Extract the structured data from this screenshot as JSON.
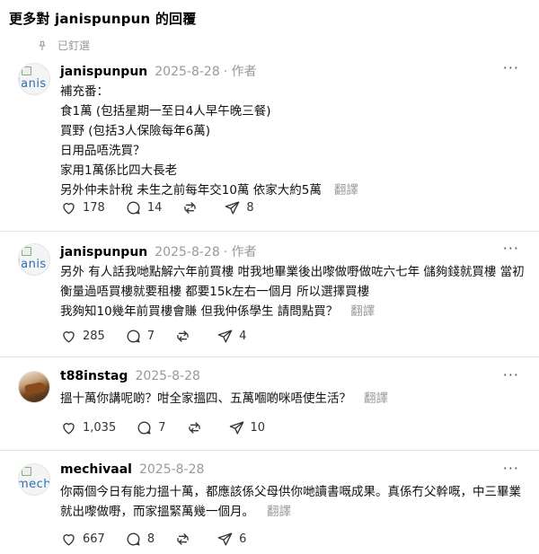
{
  "header": {
    "title": "更多對 janispunpun 的回覆"
  },
  "pinned_label": "已釘選",
  "posts": [
    {
      "avatar_text": "janis",
      "username": "janispunpun",
      "date": "2025-8-28",
      "author_tag": "· 作者",
      "lines": [
        "補充番：",
        "食1萬 (包括星期一至日4人早午晚三餐)",
        "買野 (包括3人保險每年6萬)",
        "日用品唔洗買？",
        "家用1萬係比四大長老",
        "另外仲未計稅 未生之前每年交10萬 依家大約5萬"
      ],
      "translate": "翻譯",
      "likes": "178",
      "replies": "14",
      "reposts": "",
      "shares": "8"
    },
    {
      "avatar_text": "janis",
      "username": "janispunpun",
      "date": "2025-8-28",
      "author_tag": "· 作者",
      "lines": [
        "另外 有人話我哋點解六年前買樓 咁我地畢業後出嚟做嘢做咗六七年 儲夠錢就買樓 當初衡量過唔買樓就要租樓 都要15k左右一個月 所以選擇買樓",
        "我夠知10幾年前買樓會賺 但我仲係學生 請問點買？"
      ],
      "translate": "翻譯",
      "likes": "285",
      "replies": "7",
      "reposts": "",
      "shares": "4"
    },
    {
      "avatar_text": "",
      "username": "t88instag",
      "date": "2025-8-28",
      "author_tag": "",
      "lines": [
        "搵十萬你講呢啲？咁全家搵四、五萬嗰啲咪唔使生活？"
      ],
      "translate": "翻譯",
      "likes": "1,035",
      "replies": "7",
      "reposts": "",
      "shares": "10"
    },
    {
      "avatar_text": "mech",
      "username": "mechivaal",
      "date": "2025-8-28",
      "author_tag": "",
      "lines": [
        "你兩個今日有能力搵十萬，都應該係父母供你哋讀書嘅成果。真係冇父幹嘅，中三畢業就出嚟做嘢，而家搵緊萬幾一個月。"
      ],
      "translate": "翻譯",
      "likes": "667",
      "replies": "8",
      "reposts": "",
      "shares": "6"
    }
  ],
  "colors": {
    "muted": "#999999",
    "text": "#111111",
    "divider": "#e5e5e5"
  },
  "icons": [
    "pin-icon",
    "heart-icon",
    "comment-icon",
    "repost-icon",
    "share-icon",
    "more-icon"
  ]
}
